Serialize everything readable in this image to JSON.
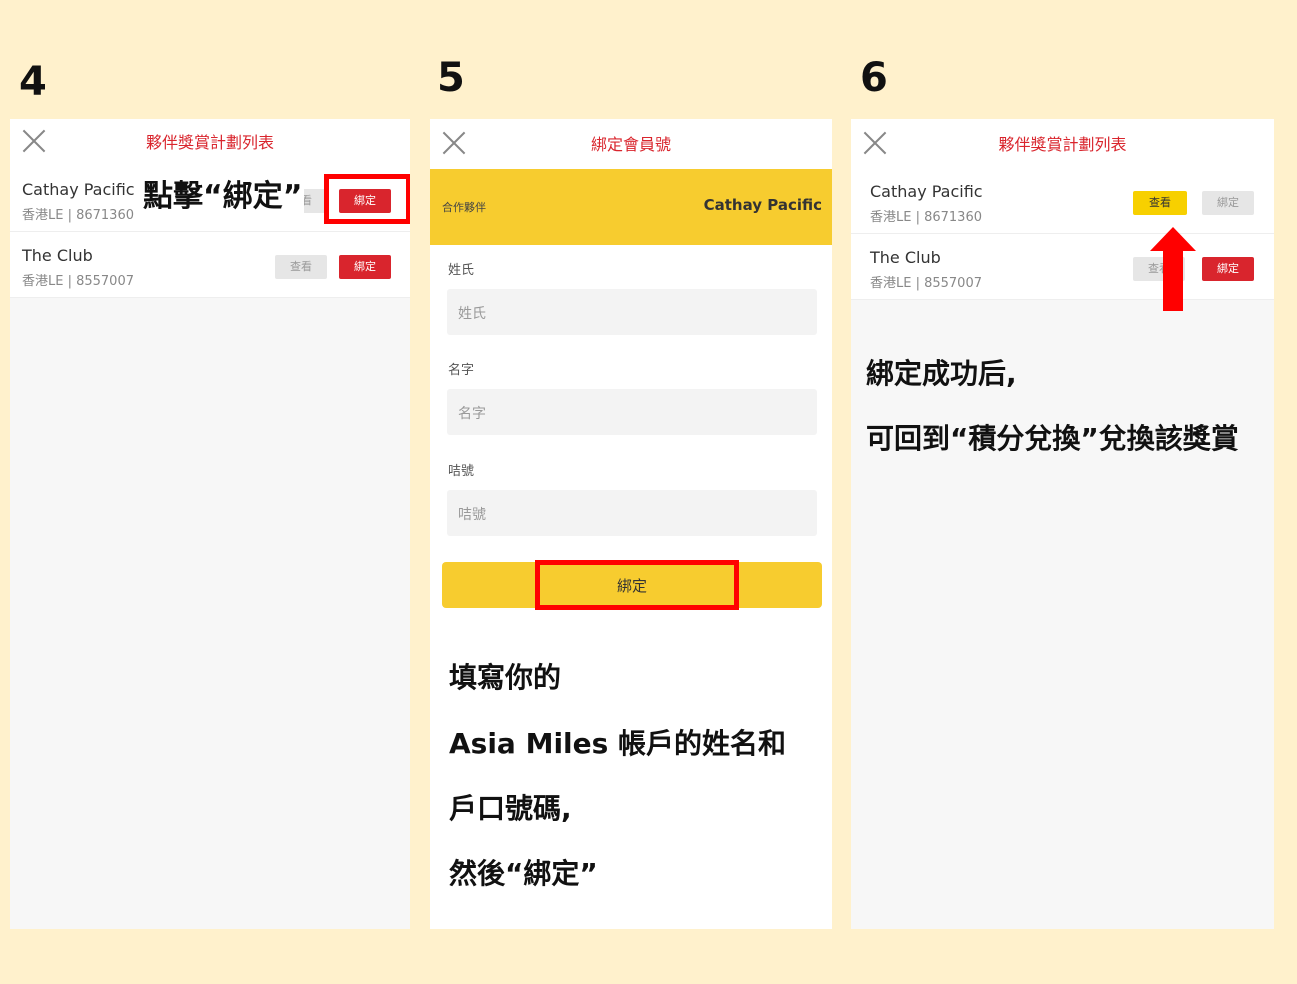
{
  "steps": [
    "4",
    "5",
    "6"
  ],
  "panel4": {
    "title": "夥伴獎賞計劃列表",
    "rows": [
      {
        "name": "Cathay Pacific",
        "meta": "香港LE  |  8671360",
        "view": "查看",
        "bind": "綁定"
      },
      {
        "name": "The Club",
        "meta": "香港LE  |  8557007",
        "view": "查看",
        "bind": "綁定"
      }
    ],
    "callout": "點擊“綁定”"
  },
  "panel5": {
    "title": "綁定會員號",
    "partner_label": "合作夥伴",
    "partner_name": "Cathay Pacific",
    "fields": [
      {
        "label": "姓氏",
        "placeholder": "姓氏"
      },
      {
        "label": "名字",
        "placeholder": "名字"
      },
      {
        "label": "咭號",
        "placeholder": "咭號"
      }
    ],
    "submit": "綁定",
    "instructions": [
      "填寫你的",
      "Asia Miles 帳戶的姓名和",
      "戶口號碼,",
      "然後“綁定”"
    ]
  },
  "panel6": {
    "title": "夥伴獎賞計劃列表",
    "rows": [
      {
        "name": "Cathay Pacific",
        "meta": "香港LE  |  8671360",
        "view": "查看",
        "bind": "綁定"
      },
      {
        "name": "The Club",
        "meta": "香港LE  |  8557007",
        "view": "查看",
        "bind": "綁定"
      }
    ],
    "notes": [
      "綁定成功后,",
      "可回到“積分兌換”兌換該獎賞"
    ]
  },
  "colors": {
    "red": "#d9252d",
    "yellow": "#f7cc2f",
    "highlight": "#ff0000",
    "background": "#fff1cc"
  },
  "icons": [
    "close-icon",
    "up-arrow-icon"
  ]
}
